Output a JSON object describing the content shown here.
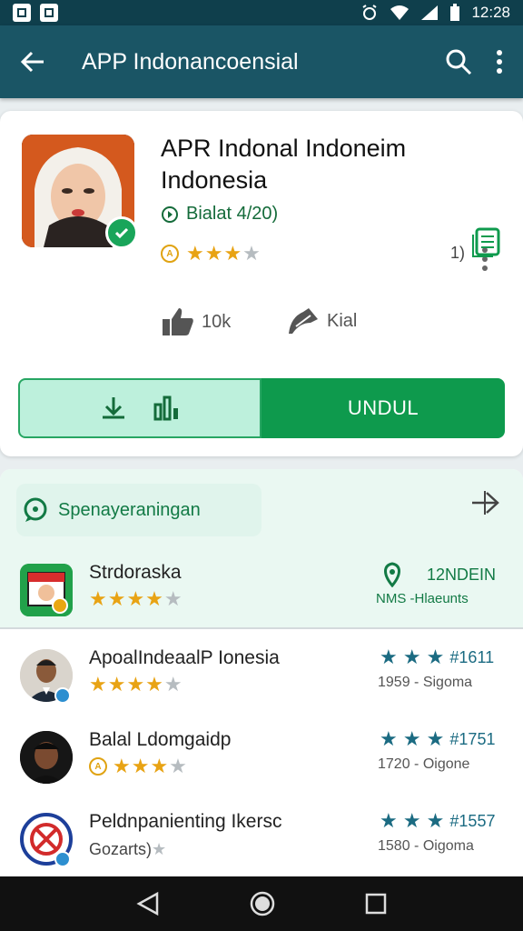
{
  "status_bar": {
    "time": "12:28"
  },
  "app_bar": {
    "title": "APP Indonancoensial"
  },
  "app": {
    "name_line1": "APR Indonal Indoneim",
    "name_line2": "Indonesia",
    "meta": "Bialat 4/20)",
    "rating_stars": 3,
    "side_count": "1)",
    "likes": "10k",
    "shares": "Kial",
    "install_label": "UNDUL"
  },
  "section": {
    "chip_label": "Spenayeraningan",
    "featured": {
      "name": "Strdoraska",
      "stars": 4,
      "right_title": "12NDEIN",
      "right_sub": "NMS -Hlaeunts"
    },
    "list": [
      {
        "name": "ApoalIndeaalP Ionesia",
        "stars": 4,
        "right_num": "#1611",
        "right_sub": "1959 - Sigoma"
      },
      {
        "name": "Balal Ldomgaidp",
        "stars": 3,
        "right_num": "#1751",
        "right_sub": "1720 - Oigone"
      },
      {
        "name": "Peldnpanienting Ikersc",
        "sub": "Gozarts)",
        "right_num": "#1557",
        "right_sub": "1580 - Oigoma"
      }
    ]
  },
  "colors": {
    "appbar": "#1a5565",
    "accent_green": "#0e9a4d",
    "star_gold": "#e8a314",
    "star_teal": "#1b6b82"
  },
  "icons": [
    "back-arrow-icon",
    "search-icon",
    "more-vert-icon",
    "verified-icon",
    "thumbs-up-icon",
    "share-icon",
    "download-icon",
    "library-icon",
    "chat-icon",
    "send-icon",
    "doc-icon",
    "location-icon"
  ]
}
